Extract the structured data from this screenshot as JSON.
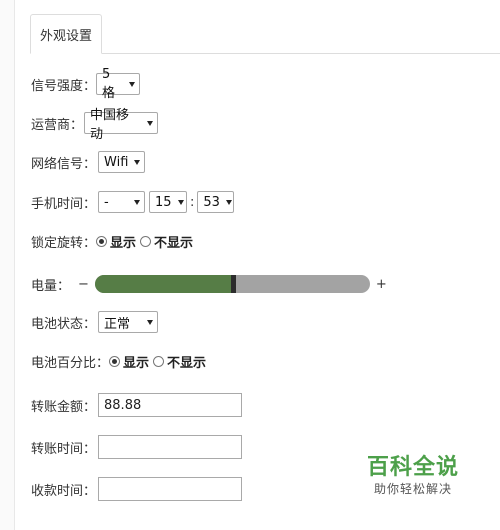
{
  "tabs": [
    {
      "label": "外观设置",
      "active": true
    }
  ],
  "signal_strength": {
    "label": "信号强度：",
    "value": "5格"
  },
  "carrier": {
    "label": "运营商：",
    "value": "中国移动"
  },
  "network": {
    "label": "网络信号：",
    "value": "Wifi"
  },
  "phone_time": {
    "label": "手机时间：",
    "period": "-",
    "hour": "15",
    "separator": ":",
    "minute": "53"
  },
  "rotation_lock": {
    "label": "锁定旋转：",
    "options": [
      "显示",
      "不显示"
    ],
    "selected": "显示"
  },
  "battery": {
    "label": "电量：",
    "minus": "−",
    "plus": "+",
    "level_percent": 50,
    "fill_color": "#567d46",
    "track_color": "#a3a3a3"
  },
  "battery_status": {
    "label": "电池状态：",
    "value": "正常"
  },
  "battery_percent": {
    "label": "电池百分比：",
    "options": [
      "显示",
      "不显示"
    ],
    "selected": "显示"
  },
  "transfer_amount": {
    "label": "转账金额：",
    "value": "88.88"
  },
  "transfer_time": {
    "label": "转账时间：",
    "value": ""
  },
  "receive_time": {
    "label": "收款时间：",
    "value": ""
  },
  "watermark": {
    "title": "百科全说",
    "subtitle": "助你轻松解决"
  }
}
